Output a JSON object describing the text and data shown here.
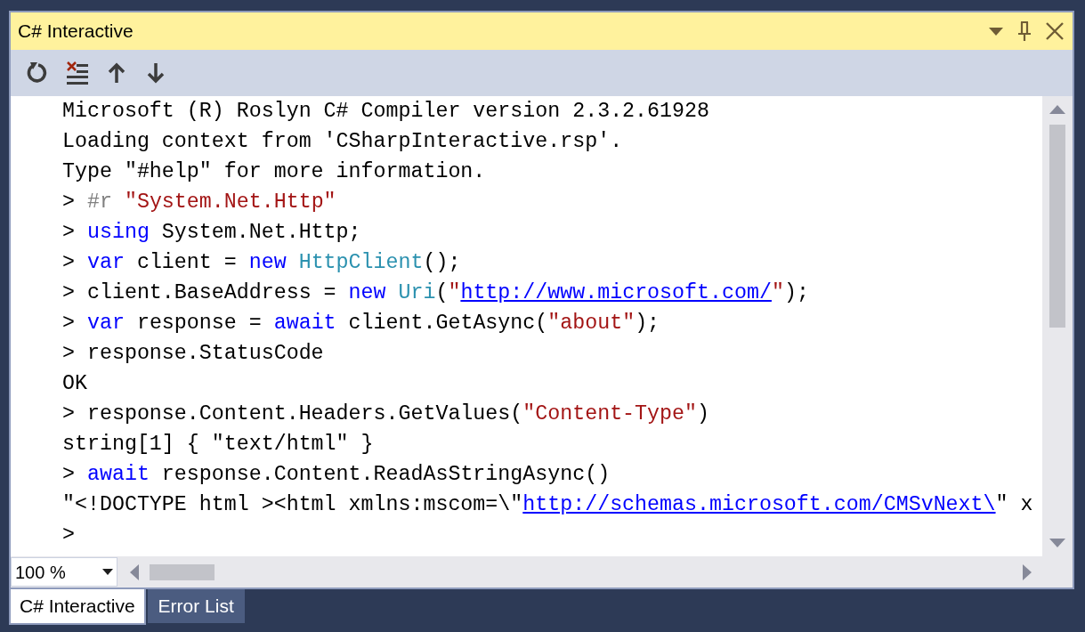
{
  "window": {
    "title": "C# Interactive"
  },
  "toolbar": {
    "buttons": [
      {
        "kind": "reset"
      },
      {
        "kind": "clear"
      },
      {
        "kind": "up"
      },
      {
        "kind": "down"
      }
    ]
  },
  "editor": {
    "lines": [
      {
        "tokens": [
          {
            "kind": "plain",
            "text": "Microsoft (R) Roslyn C# Compiler version 2.3.2.61928"
          }
        ]
      },
      {
        "tokens": [
          {
            "kind": "plain",
            "text": "Loading context from 'CSharpInteractive.rsp'."
          }
        ]
      },
      {
        "tokens": [
          {
            "kind": "plain",
            "text": "Type \"#help\" for more information."
          }
        ]
      },
      {
        "tokens": [
          {
            "kind": "plain",
            "text": "> "
          },
          {
            "kind": "directive",
            "text": "#r "
          },
          {
            "kind": "string",
            "text": "\"System.Net.Http\""
          }
        ]
      },
      {
        "tokens": [
          {
            "kind": "plain",
            "text": "> "
          },
          {
            "kind": "keyword",
            "text": "using"
          },
          {
            "kind": "plain",
            "text": " System.Net.Http;"
          }
        ]
      },
      {
        "tokens": [
          {
            "kind": "plain",
            "text": "> "
          },
          {
            "kind": "keyword",
            "text": "var"
          },
          {
            "kind": "plain",
            "text": " client = "
          },
          {
            "kind": "keyword",
            "text": "new "
          },
          {
            "kind": "type",
            "text": "HttpClient"
          },
          {
            "kind": "plain",
            "text": "();"
          }
        ]
      },
      {
        "tokens": [
          {
            "kind": "plain",
            "text": "> client.BaseAddress = "
          },
          {
            "kind": "keyword",
            "text": "new "
          },
          {
            "kind": "type",
            "text": "Uri"
          },
          {
            "kind": "plain",
            "text": "("
          },
          {
            "kind": "string",
            "text": "\""
          },
          {
            "kind": "link",
            "text": "http://www.microsoft.com/"
          },
          {
            "kind": "string",
            "text": "\""
          },
          {
            "kind": "plain",
            "text": ");"
          }
        ]
      },
      {
        "tokens": [
          {
            "kind": "plain",
            "text": "> "
          },
          {
            "kind": "keyword",
            "text": "var"
          },
          {
            "kind": "plain",
            "text": " response = "
          },
          {
            "kind": "keyword",
            "text": "await"
          },
          {
            "kind": "plain",
            "text": " client.GetAsync("
          },
          {
            "kind": "string",
            "text": "\"about\""
          },
          {
            "kind": "plain",
            "text": ");"
          }
        ]
      },
      {
        "tokens": [
          {
            "kind": "plain",
            "text": "> response.StatusCode"
          }
        ]
      },
      {
        "tokens": [
          {
            "kind": "plain",
            "text": "OK"
          }
        ]
      },
      {
        "tokens": [
          {
            "kind": "plain",
            "text": "> response.Content.Headers.GetValues("
          },
          {
            "kind": "string",
            "text": "\"Content-Type\""
          },
          {
            "kind": "plain",
            "text": ")"
          }
        ]
      },
      {
        "tokens": [
          {
            "kind": "plain",
            "text": "string[1] { \"text/html\" }"
          }
        ]
      },
      {
        "tokens": [
          {
            "kind": "plain",
            "text": "> "
          },
          {
            "kind": "keyword",
            "text": "await"
          },
          {
            "kind": "plain",
            "text": " response.Content.ReadAsStringAsync()"
          }
        ]
      },
      {
        "tokens": [
          {
            "kind": "plain",
            "text": "\"<!DOCTYPE html ><html xmlns:mscom=\\\""
          },
          {
            "kind": "link",
            "text": "http://schemas.microsoft.com/CMSvNext\\"
          },
          {
            "kind": "plain",
            "text": "\" x"
          }
        ]
      },
      {
        "tokens": [
          {
            "kind": "plain",
            "text": ">"
          }
        ]
      }
    ]
  },
  "zoom": {
    "value": "100 %"
  },
  "tabs": [
    {
      "label": "C# Interactive",
      "selected": true
    },
    {
      "label": "Error List",
      "selected": false
    }
  ]
}
